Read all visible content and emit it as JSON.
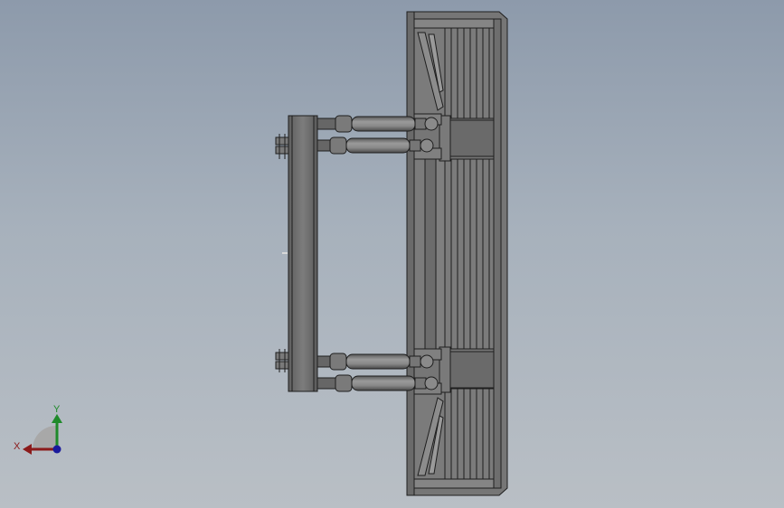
{
  "triad": {
    "x_label": "X",
    "y_label": "Y",
    "x_color": "#8b1a1a",
    "y_color": "#1f8a2a",
    "z_color": "#1a1a9c"
  },
  "colors": {
    "background_top": "#8d9aab",
    "background_bottom": "#b9bfc5",
    "part_fill": "#6f6f6f",
    "part_light": "#8a8a8a",
    "edge": "#1e1e1e"
  }
}
